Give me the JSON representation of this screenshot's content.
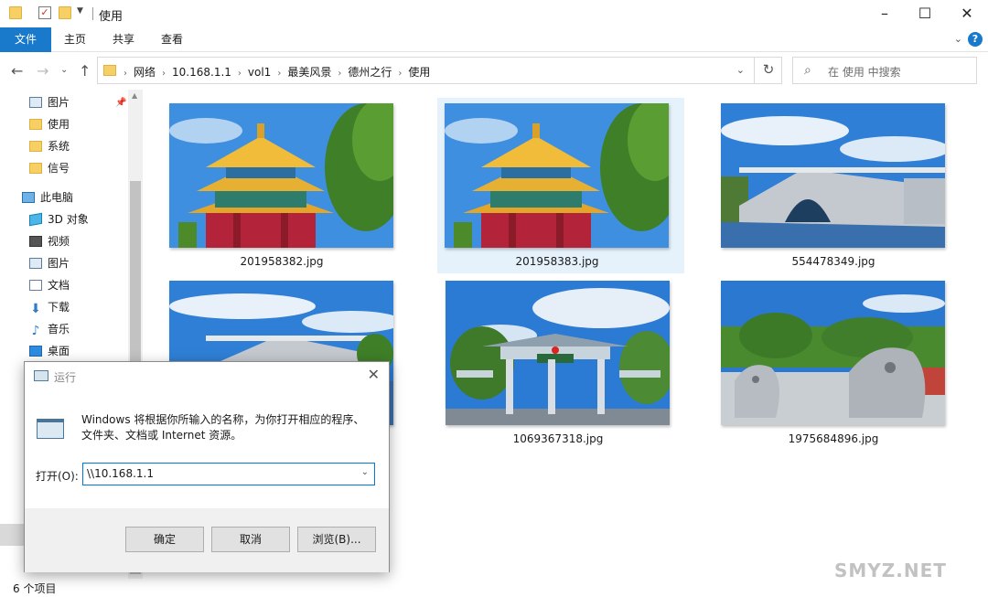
{
  "window": {
    "title": "使用"
  },
  "ribbon": {
    "tabs": [
      "文件",
      "主页",
      "共享",
      "查看"
    ],
    "help_label": "?"
  },
  "address": {
    "crumbs": [
      "网络",
      "10.168.1.1",
      "vol1",
      "最美风景",
      "德州之行",
      "使用"
    ],
    "search_placeholder": "在 使用 中搜索"
  },
  "sidebar": {
    "quick_access": [
      {
        "label": "图片",
        "icon": "pictures-icon"
      },
      {
        "label": "使用",
        "icon": "folder-icon"
      },
      {
        "label": "系统",
        "icon": "folder-icon"
      },
      {
        "label": "信号",
        "icon": "folder-icon"
      }
    ],
    "this_pc": "此电脑",
    "pc_items": [
      {
        "label": "3D 对象",
        "icon": "3d-objects-icon"
      },
      {
        "label": "视频",
        "icon": "video-icon"
      },
      {
        "label": "图片",
        "icon": "pictures-icon"
      },
      {
        "label": "文档",
        "icon": "documents-icon"
      },
      {
        "label": "下载",
        "icon": "download-icon"
      },
      {
        "label": "音乐",
        "icon": "music-icon"
      },
      {
        "label": "桌面",
        "icon": "desktop-icon"
      }
    ]
  },
  "files": [
    {
      "name": "201958382.jpg",
      "image": "pavilion-photo",
      "selected": false
    },
    {
      "name": "201958383.jpg",
      "image": "pavilion-photo",
      "selected": true
    },
    {
      "name": "554478349.jpg",
      "image": "arch-bridge-photo",
      "selected": false
    },
    {
      "name": "",
      "image": "arch-bridge-photo",
      "selected": false
    },
    {
      "name": "1069367318.jpg",
      "image": "memorial-gate-photo",
      "selected": false
    },
    {
      "name": "1975684896.jpg",
      "image": "stone-lion-photo",
      "selected": false
    }
  ],
  "status": {
    "item_count": "6 个项目"
  },
  "watermark": "SMYZ.NET",
  "run_dialog": {
    "title": "运行",
    "description": "Windows 将根据你所输入的名称，为你打开相应的程序、文件夹、文档或 Internet 资源。",
    "open_label": "打开(O):",
    "input_value": "\\\\10.168.1.1",
    "buttons": {
      "ok": "确定",
      "cancel": "取消",
      "browse": "浏览(B)..."
    }
  },
  "colors": {
    "accent": "#1979ca",
    "selection": "#e5f1fb",
    "folder": "#f6d065"
  }
}
